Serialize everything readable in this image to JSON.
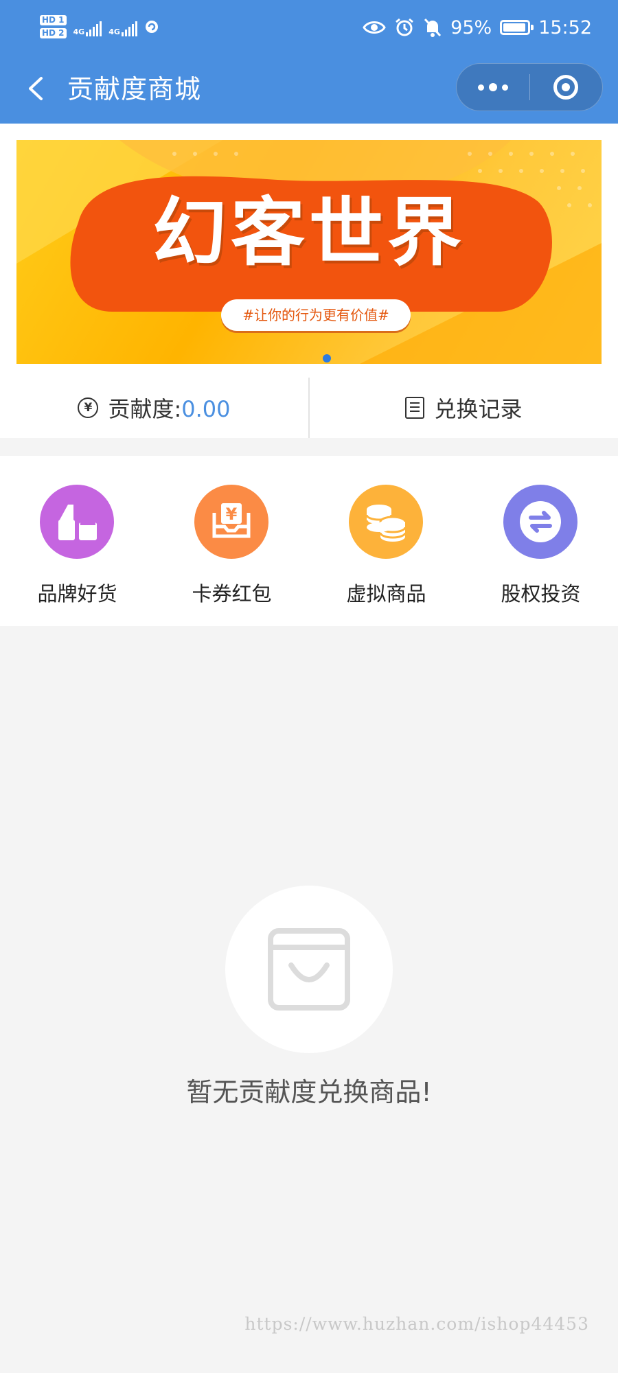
{
  "status_bar": {
    "hd1": "HD 1",
    "hd2": "HD 2",
    "net1": "4G",
    "net2": "4G",
    "battery": "95%",
    "battery_level": 0.95,
    "time": "15:52"
  },
  "navbar": {
    "title": "贡献度商城",
    "accent_color": "#4a8fe0"
  },
  "banner": {
    "title": "幻客世界",
    "tagline": "#让你的行为更有价值#",
    "active_slide": 1,
    "slide_count": 1
  },
  "stats": {
    "contribution_label": "贡献度:",
    "contribution_value": "0.00",
    "yen_icon": "¥",
    "records_label": "兑换记录"
  },
  "categories": [
    {
      "label": "品牌好货",
      "icon": "lipstick-icon",
      "color": "#c565e0"
    },
    {
      "label": "卡券红包",
      "icon": "coupon-icon",
      "color": "#fb8b45"
    },
    {
      "label": "虚拟商品",
      "icon": "coins-icon",
      "color": "#fdb23a"
    },
    {
      "label": "股权投资",
      "icon": "exchange-icon",
      "color": "#7f7fe8"
    }
  ],
  "empty_state": {
    "icon": "shopping-bag-icon",
    "text": "暂无贡献度兑换商品!"
  },
  "watermark": "https://www.huzhan.com/ishop44453"
}
